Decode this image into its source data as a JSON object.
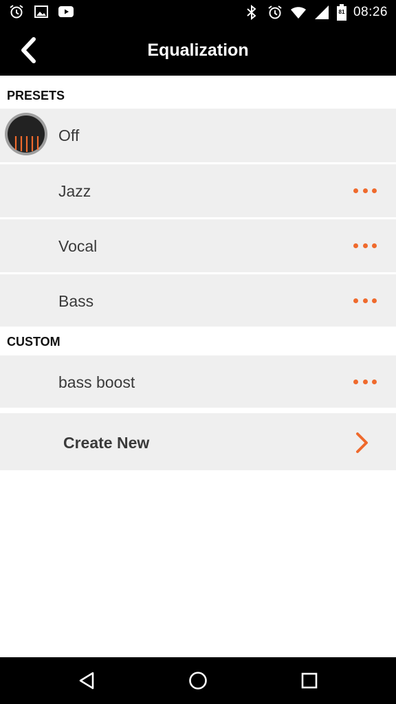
{
  "status_bar": {
    "time": "08:26",
    "battery_level": "81",
    "left_icons": [
      "alarm-icon",
      "image-icon",
      "youtube-icon"
    ],
    "right_icons": [
      "bluetooth-icon",
      "alarm-icon",
      "wifi-icon",
      "signal-icon",
      "battery-icon"
    ]
  },
  "header": {
    "title": "Equalization",
    "back_icon": "chevron-left-icon"
  },
  "presets": {
    "header": "PRESETS",
    "items": [
      {
        "label": "Off",
        "selected": true
      },
      {
        "label": "Jazz",
        "has_menu": true
      },
      {
        "label": "Vocal",
        "has_menu": true
      },
      {
        "label": "Bass",
        "has_menu": true
      }
    ]
  },
  "custom": {
    "header": "CUSTOM",
    "items": [
      {
        "label": "bass boost",
        "has_menu": true
      }
    ]
  },
  "create_new": {
    "label": "Create New",
    "icon": "chevron-right-icon"
  },
  "nav_bar": {
    "buttons": [
      "back-triangle-icon",
      "home-circle-icon",
      "recents-square-icon"
    ]
  },
  "colors": {
    "accent": "#ef6a2d",
    "bar_background": "#000000",
    "row_background": "#efefef",
    "page_background": "#ffffff"
  }
}
